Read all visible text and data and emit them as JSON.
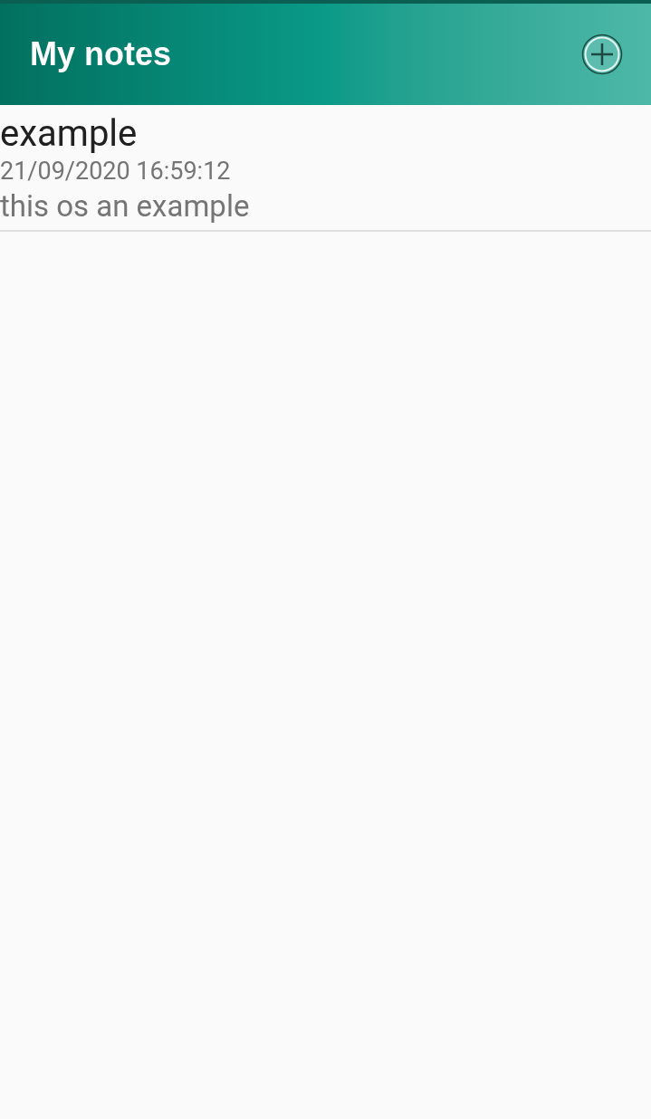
{
  "app_bar": {
    "title": "My notes"
  },
  "notes": [
    {
      "title": "example",
      "timestamp": "21/09/2020 16:59:12",
      "body": "this os an example"
    }
  ]
}
